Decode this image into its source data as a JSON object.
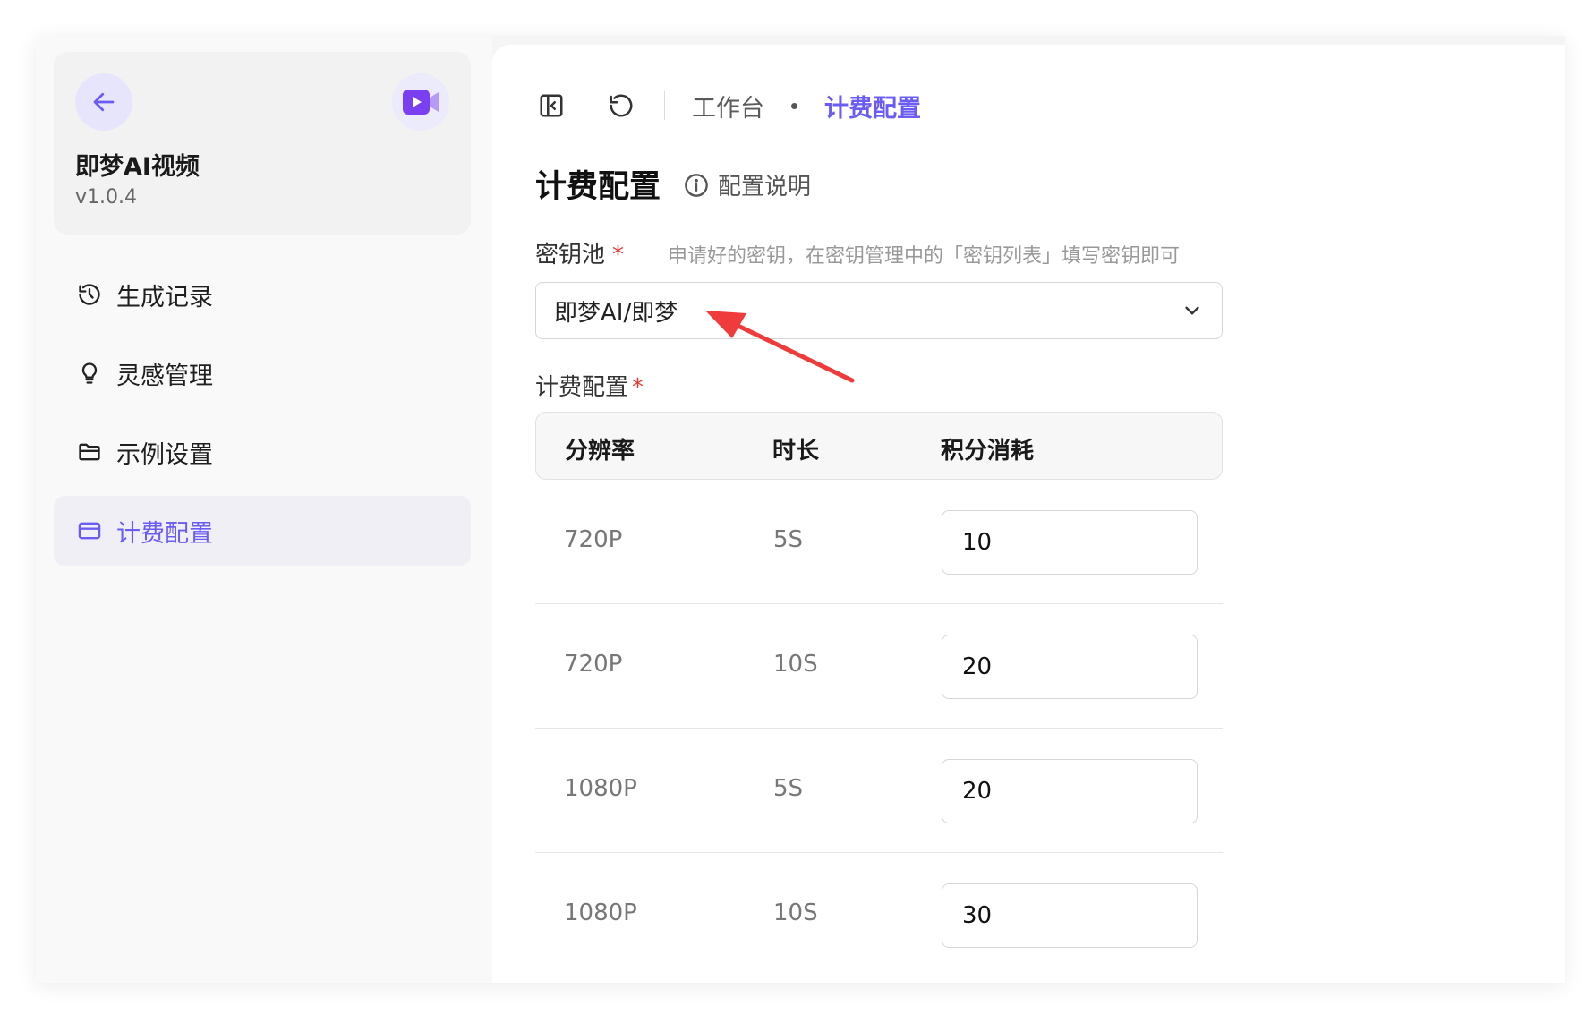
{
  "sidebar": {
    "app_name": "即梦AI视频",
    "version": "v1.0.4",
    "items": [
      {
        "label": "生成记录",
        "icon": "history-icon",
        "active": false
      },
      {
        "label": "灵感管理",
        "icon": "lightbulb-icon",
        "active": false
      },
      {
        "label": "示例设置",
        "icon": "folder-icon",
        "active": false
      },
      {
        "label": "计费配置",
        "icon": "card-icon",
        "active": true
      }
    ]
  },
  "header": {
    "breadcrumb_root": "工作台",
    "breadcrumb_current": "计费配置"
  },
  "page": {
    "title": "计费配置",
    "help_link": "配置说明",
    "key_pool": {
      "label": "密钥池",
      "required_mark": "*",
      "hint": "申请好的密钥，在密钥管理中的「密钥列表」填写密钥即可",
      "selected": "即梦AI/即梦"
    },
    "billing": {
      "label": "计费配置",
      "required_mark": "*",
      "columns": [
        "分辨率",
        "时长",
        "积分消耗"
      ],
      "rows": [
        {
          "resolution": "720P",
          "duration": "5S",
          "cost": "10"
        },
        {
          "resolution": "720P",
          "duration": "10S",
          "cost": "20"
        },
        {
          "resolution": "1080P",
          "duration": "5S",
          "cost": "20"
        },
        {
          "resolution": "1080P",
          "duration": "10S",
          "cost": "30"
        }
      ]
    }
  },
  "colors": {
    "accent": "#6b5cf5",
    "required": "#e53935",
    "annotation_arrow": "#ef3b3b"
  }
}
